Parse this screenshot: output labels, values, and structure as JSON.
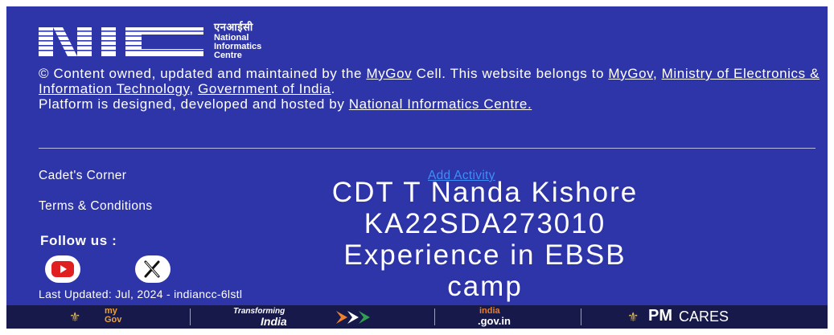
{
  "logo": {
    "hindi": "एनआईसी",
    "lines": [
      "National",
      "Informatics",
      "Centre"
    ]
  },
  "content": {
    "p1_a": "© Content owned, updated and maintained by the ",
    "mygov_cell": "MyGov",
    "p1_b": " Cell. This website belongs to ",
    "mygov": "MyGov",
    "comma1": ", ",
    "ministry": "Ministry of Electronics & Information Technology",
    "comma2": ", ",
    "goi": "Government of India",
    "period": ".",
    "p2": "Platform is designed, developed and hosted by ",
    "nic": "National Informatics Centre."
  },
  "links": {
    "cadets_corner": "Cadet's Corner",
    "terms": "Terms & Conditions",
    "add_activity": "Add Activity"
  },
  "follow_label": "Follow us :",
  "last_updated": "Last Updated: Jul, 2024 - indiancc-6lstl",
  "overlay": [
    "CDT T Nanda Kishore",
    "KA22SDA273010",
    "Experience in EBSB",
    "camp"
  ],
  "bottom_bar": {
    "mygov": "my Gov",
    "transforming": "Transforming",
    "india": "India",
    "indiagov": ".gov.in",
    "indiagov_top": "india",
    "pm": "PM",
    "cares": "CARES"
  },
  "colors": {
    "background": "#2e35a8",
    "link_blue": "#3e8ef7",
    "bottom_bar": "#17194a",
    "youtube_red": "#e02020"
  }
}
